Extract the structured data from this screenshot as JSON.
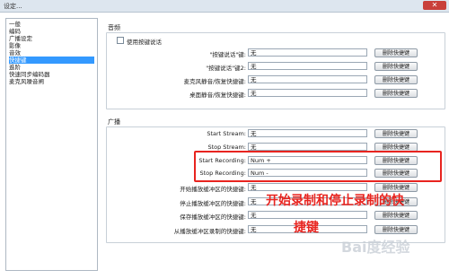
{
  "window": {
    "title": "设定..."
  },
  "sidebar": {
    "items": [
      {
        "label": "一般",
        "selected": false
      },
      {
        "label": "编码",
        "selected": false
      },
      {
        "label": "广播设定",
        "selected": false
      },
      {
        "label": "影像",
        "selected": false
      },
      {
        "label": "音效",
        "selected": false
      },
      {
        "label": "快捷键",
        "selected": true
      },
      {
        "label": "進阶",
        "selected": false
      },
      {
        "label": "快速同步编码器",
        "selected": false
      },
      {
        "label": "麦克风噪音闸",
        "selected": false
      }
    ]
  },
  "audio": {
    "title": "音频",
    "ptt_checkbox": "使用按键说话",
    "rows": [
      {
        "label": "\"按键说话\"键:",
        "value": "无",
        "button": "删除快捷键"
      },
      {
        "label": "\"按键说话\"键2:",
        "value": "无",
        "button": "删除快捷键"
      },
      {
        "label": "麦克风静音/恢复快捷键:",
        "value": "无",
        "button": "删除快捷键"
      },
      {
        "label": "桌面静音/恢复快捷键:",
        "value": "无",
        "button": "删除快捷键"
      }
    ]
  },
  "broadcast": {
    "title": "广播",
    "rows": [
      {
        "label": "Start Stream:",
        "value": "无",
        "button": "删除快捷键"
      },
      {
        "label": "Stop Stream:",
        "value": "无",
        "button": "删除快捷键"
      },
      {
        "label": "Start Recording:",
        "value": "Num +",
        "button": "删除快捷键"
      },
      {
        "label": "Stop Recording:",
        "value": "Num -",
        "button": "删除快捷键"
      },
      {
        "label": "开始播放缓冲区的快捷键:",
        "value": "无",
        "button": "删除快捷键"
      },
      {
        "label": "停止播放缓冲区的快捷键:",
        "value": "无",
        "button": "删除快捷键"
      },
      {
        "label": "保存播放缓冲区的快捷键:",
        "value": "无",
        "button": "删除快捷键"
      },
      {
        "label": "从播放缓冲区录制的快捷键:",
        "value": "无",
        "button": "删除快捷键"
      }
    ]
  },
  "annotation": {
    "line1": "开始录制和停止录制的快",
    "line2": "捷键"
  },
  "watermark": {
    "text": "Bai度经验"
  },
  "colors": {
    "selection": "#3399ff",
    "annotation_red": "#e8241f"
  }
}
